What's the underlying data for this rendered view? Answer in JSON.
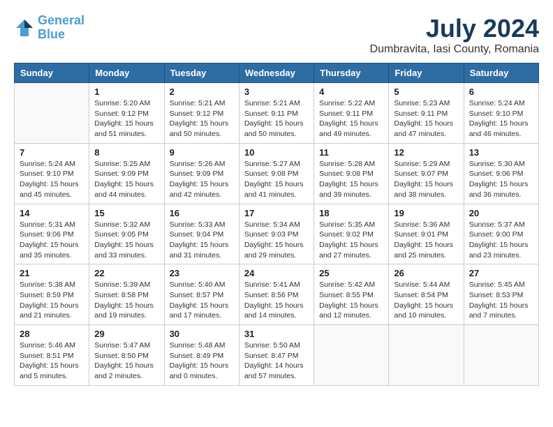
{
  "header": {
    "logo_line1": "General",
    "logo_line2": "Blue",
    "title": "July 2024",
    "location": "Dumbravita, Iasi County, Romania"
  },
  "days_of_week": [
    "Sunday",
    "Monday",
    "Tuesday",
    "Wednesday",
    "Thursday",
    "Friday",
    "Saturday"
  ],
  "weeks": [
    [
      {
        "day": "",
        "info": ""
      },
      {
        "day": "1",
        "info": "Sunrise: 5:20 AM\nSunset: 9:12 PM\nDaylight: 15 hours\nand 51 minutes."
      },
      {
        "day": "2",
        "info": "Sunrise: 5:21 AM\nSunset: 9:12 PM\nDaylight: 15 hours\nand 50 minutes."
      },
      {
        "day": "3",
        "info": "Sunrise: 5:21 AM\nSunset: 9:11 PM\nDaylight: 15 hours\nand 50 minutes."
      },
      {
        "day": "4",
        "info": "Sunrise: 5:22 AM\nSunset: 9:11 PM\nDaylight: 15 hours\nand 49 minutes."
      },
      {
        "day": "5",
        "info": "Sunrise: 5:23 AM\nSunset: 9:11 PM\nDaylight: 15 hours\nand 47 minutes."
      },
      {
        "day": "6",
        "info": "Sunrise: 5:24 AM\nSunset: 9:10 PM\nDaylight: 15 hours\nand 46 minutes."
      }
    ],
    [
      {
        "day": "7",
        "info": "Sunrise: 5:24 AM\nSunset: 9:10 PM\nDaylight: 15 hours\nand 45 minutes."
      },
      {
        "day": "8",
        "info": "Sunrise: 5:25 AM\nSunset: 9:09 PM\nDaylight: 15 hours\nand 44 minutes."
      },
      {
        "day": "9",
        "info": "Sunrise: 5:26 AM\nSunset: 9:09 PM\nDaylight: 15 hours\nand 42 minutes."
      },
      {
        "day": "10",
        "info": "Sunrise: 5:27 AM\nSunset: 9:08 PM\nDaylight: 15 hours\nand 41 minutes."
      },
      {
        "day": "11",
        "info": "Sunrise: 5:28 AM\nSunset: 9:08 PM\nDaylight: 15 hours\nand 39 minutes."
      },
      {
        "day": "12",
        "info": "Sunrise: 5:29 AM\nSunset: 9:07 PM\nDaylight: 15 hours\nand 38 minutes."
      },
      {
        "day": "13",
        "info": "Sunrise: 5:30 AM\nSunset: 9:06 PM\nDaylight: 15 hours\nand 36 minutes."
      }
    ],
    [
      {
        "day": "14",
        "info": "Sunrise: 5:31 AM\nSunset: 9:06 PM\nDaylight: 15 hours\nand 35 minutes."
      },
      {
        "day": "15",
        "info": "Sunrise: 5:32 AM\nSunset: 9:05 PM\nDaylight: 15 hours\nand 33 minutes."
      },
      {
        "day": "16",
        "info": "Sunrise: 5:33 AM\nSunset: 9:04 PM\nDaylight: 15 hours\nand 31 minutes."
      },
      {
        "day": "17",
        "info": "Sunrise: 5:34 AM\nSunset: 9:03 PM\nDaylight: 15 hours\nand 29 minutes."
      },
      {
        "day": "18",
        "info": "Sunrise: 5:35 AM\nSunset: 9:02 PM\nDaylight: 15 hours\nand 27 minutes."
      },
      {
        "day": "19",
        "info": "Sunrise: 5:36 AM\nSunset: 9:01 PM\nDaylight: 15 hours\nand 25 minutes."
      },
      {
        "day": "20",
        "info": "Sunrise: 5:37 AM\nSunset: 9:00 PM\nDaylight: 15 hours\nand 23 minutes."
      }
    ],
    [
      {
        "day": "21",
        "info": "Sunrise: 5:38 AM\nSunset: 8:59 PM\nDaylight: 15 hours\nand 21 minutes."
      },
      {
        "day": "22",
        "info": "Sunrise: 5:39 AM\nSunset: 8:58 PM\nDaylight: 15 hours\nand 19 minutes."
      },
      {
        "day": "23",
        "info": "Sunrise: 5:40 AM\nSunset: 8:57 PM\nDaylight: 15 hours\nand 17 minutes."
      },
      {
        "day": "24",
        "info": "Sunrise: 5:41 AM\nSunset: 8:56 PM\nDaylight: 15 hours\nand 14 minutes."
      },
      {
        "day": "25",
        "info": "Sunrise: 5:42 AM\nSunset: 8:55 PM\nDaylight: 15 hours\nand 12 minutes."
      },
      {
        "day": "26",
        "info": "Sunrise: 5:44 AM\nSunset: 8:54 PM\nDaylight: 15 hours\nand 10 minutes."
      },
      {
        "day": "27",
        "info": "Sunrise: 5:45 AM\nSunset: 8:53 PM\nDaylight: 15 hours\nand 7 minutes."
      }
    ],
    [
      {
        "day": "28",
        "info": "Sunrise: 5:46 AM\nSunset: 8:51 PM\nDaylight: 15 hours\nand 5 minutes."
      },
      {
        "day": "29",
        "info": "Sunrise: 5:47 AM\nSunset: 8:50 PM\nDaylight: 15 hours\nand 2 minutes."
      },
      {
        "day": "30",
        "info": "Sunrise: 5:48 AM\nSunset: 8:49 PM\nDaylight: 15 hours\nand 0 minutes."
      },
      {
        "day": "31",
        "info": "Sunrise: 5:50 AM\nSunset: 8:47 PM\nDaylight: 14 hours\nand 57 minutes."
      },
      {
        "day": "",
        "info": ""
      },
      {
        "day": "",
        "info": ""
      },
      {
        "day": "",
        "info": ""
      }
    ]
  ]
}
